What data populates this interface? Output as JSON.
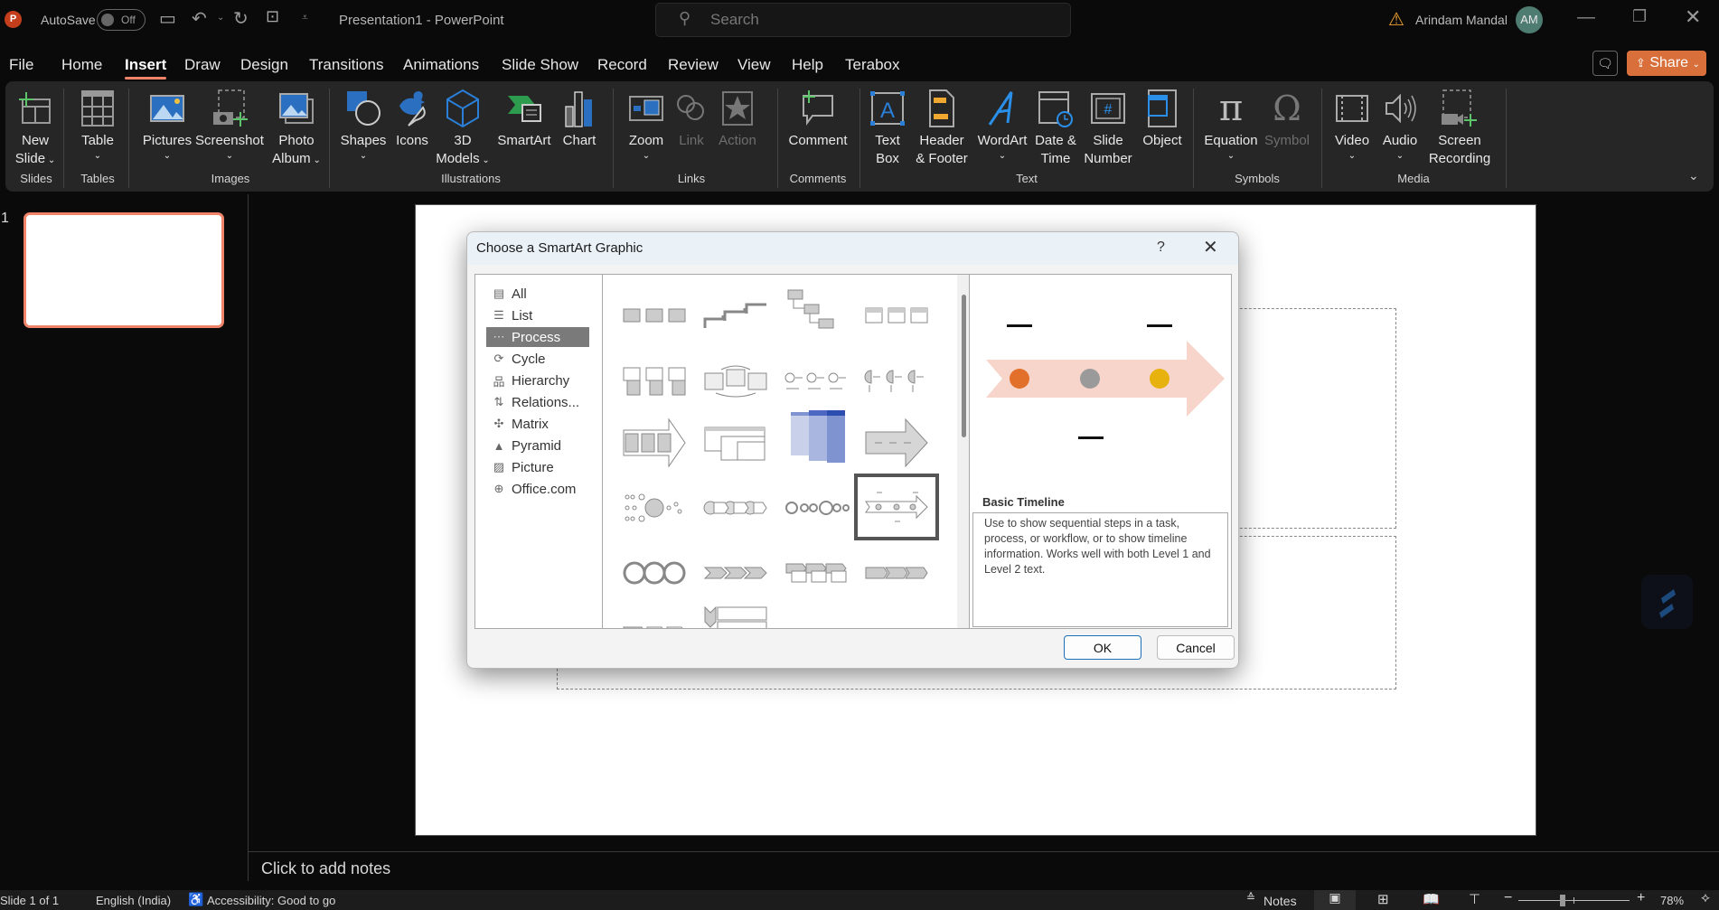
{
  "app": {
    "autosave_label": "AutoSave",
    "autosave_state": "Off",
    "doc_title": "Presentation1  -  PowerPoint",
    "search_placeholder": "Search",
    "user_name": "Arindam Mandal",
    "user_initials": "AM",
    "share_label": "Share"
  },
  "tabs": [
    "File",
    "Home",
    "Insert",
    "Draw",
    "Design",
    "Transitions",
    "Animations",
    "Slide Show",
    "Record",
    "Review",
    "View",
    "Help",
    "Terabox"
  ],
  "active_tab": "Insert",
  "ribbon": {
    "buttons": {
      "new_slide": [
        "New",
        "Slide"
      ],
      "table": "Table",
      "pictures": "Pictures",
      "screenshot": "Screenshot",
      "photo_album": [
        "Photo",
        "Album"
      ],
      "shapes": "Shapes",
      "icons": "Icons",
      "models3d": [
        "3D",
        "Models"
      ],
      "smartart": "SmartArt",
      "chart": "Chart",
      "zoom": "Zoom",
      "link": "Link",
      "action": "Action",
      "comment": "Comment",
      "text_box": [
        "Text",
        "Box"
      ],
      "header_footer": [
        "Header",
        "& Footer"
      ],
      "wordart": "WordArt",
      "date_time": [
        "Date &",
        "Time"
      ],
      "slide_number": [
        "Slide",
        "Number"
      ],
      "object": "Object",
      "equation": "Equation",
      "symbol": "Symbol",
      "video": "Video",
      "audio": "Audio",
      "screen_recording": [
        "Screen",
        "Recording"
      ]
    },
    "groups": [
      "Slides",
      "Tables",
      "Images",
      "Illustrations",
      "Links",
      "Comments",
      "Text",
      "Symbols",
      "Media"
    ]
  },
  "slides_panel": {
    "slide_number": "1"
  },
  "notes_placeholder": "Click to add notes",
  "status": {
    "slide_info": "Slide 1 of 1",
    "language": "English (India)",
    "accessibility": "Accessibility: Good to go",
    "notes_label": "Notes",
    "zoom_percent": "78%",
    "zoom_level": 78
  },
  "dialog": {
    "title": "Choose a SmartArt Graphic",
    "help": "?",
    "categories": [
      {
        "label": "All",
        "icon": "all-icon"
      },
      {
        "label": "List",
        "icon": "list-icon"
      },
      {
        "label": "Process",
        "icon": "process-icon",
        "selected": true
      },
      {
        "label": "Cycle",
        "icon": "cycle-icon"
      },
      {
        "label": "Hierarchy",
        "icon": "hierarchy-icon"
      },
      {
        "label": "Relations...",
        "icon": "relationship-icon"
      },
      {
        "label": "Matrix",
        "icon": "matrix-icon"
      },
      {
        "label": "Pyramid",
        "icon": "pyramid-icon"
      },
      {
        "label": "Picture",
        "icon": "picture-icon"
      },
      {
        "label": "Office.com",
        "icon": "globe-icon"
      }
    ],
    "selected_layout": "Basic Timeline",
    "preview_description": "Use to show sequential steps in a task, process, or workflow, or to show timeline information. Works well with both Level 1 and Level 2 text.",
    "ok_label": "OK",
    "cancel_label": "Cancel",
    "preview_colors": [
      "#e2702b",
      "#9a9a9a",
      "#e8b20e"
    ],
    "arrow_color": "#f7d5cb"
  }
}
